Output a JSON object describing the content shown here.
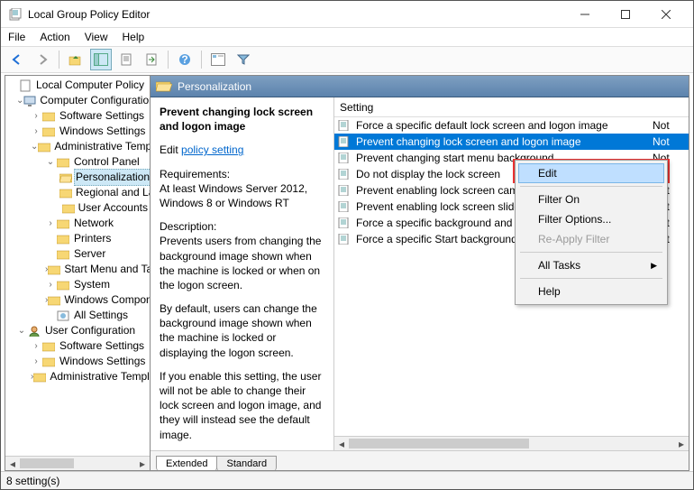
{
  "window": {
    "title": "Local Group Policy Editor"
  },
  "menu": {
    "file": "File",
    "action": "Action",
    "view": "View",
    "help": "Help"
  },
  "tree": {
    "root": "Local Computer Policy",
    "cc": "Computer Configuration",
    "ss": "Software Settings",
    "ws": "Windows Settings",
    "at": "Administrative Templates",
    "cp": "Control Panel",
    "pers": "Personalization",
    "reg": "Regional and Language Options",
    "ua": "User Accounts",
    "net": "Network",
    "prn": "Printers",
    "srv": "Server",
    "sm": "Start Menu and Taskbar",
    "sys": "System",
    "wc": "Windows Components",
    "all": "All Settings",
    "uc": "User Configuration",
    "uss": "Software Settings",
    "uws": "Windows Settings",
    "uat": "Administrative Templates"
  },
  "crumb": {
    "title": "Personalization"
  },
  "desc": {
    "heading": "Prevent changing lock screen and logon image",
    "edit_prefix": "Edit ",
    "edit_link": "policy setting ",
    "req_label": "Requirements:",
    "req_text": "At least Windows Server 2012, Windows 8 or Windows RT",
    "desc_label": "Description:",
    "desc_p1": "Prevents users from changing the background image shown when the machine is locked or when on the logon screen.",
    "desc_p2": "By default, users can change the background image shown when the machine is locked or displaying the logon screen.",
    "desc_p3": "If you enable this setting, the user will not be able to change their lock screen and logon image, and they will instead see the default image."
  },
  "list": {
    "header_setting": "Setting",
    "items": [
      {
        "label": "Force a specific default lock screen and logon image",
        "state": "Not configured"
      },
      {
        "label": "Prevent changing lock screen and logon image",
        "state": "Not configured",
        "selected": true
      },
      {
        "label": "Prevent changing start menu background",
        "state": "Not configured"
      },
      {
        "label": "Do not display the lock screen",
        "state": "Not configured"
      },
      {
        "label": "Prevent enabling lock screen camera",
        "state": "Not configured"
      },
      {
        "label": "Prevent enabling lock screen slide show",
        "state": "Not configured"
      },
      {
        "label": "Force a specific background and accent color",
        "state": "Not configured"
      },
      {
        "label": "Force a specific Start background",
        "state": "Not configured"
      }
    ]
  },
  "ctx": {
    "edit": "Edit",
    "filter_on": "Filter On",
    "filter_options": "Filter Options...",
    "reapply": "Re-Apply Filter",
    "all_tasks": "All Tasks",
    "help": "Help"
  },
  "tabs": {
    "extended": "Extended",
    "standard": "Standard"
  },
  "status": {
    "text": "8 setting(s)"
  }
}
